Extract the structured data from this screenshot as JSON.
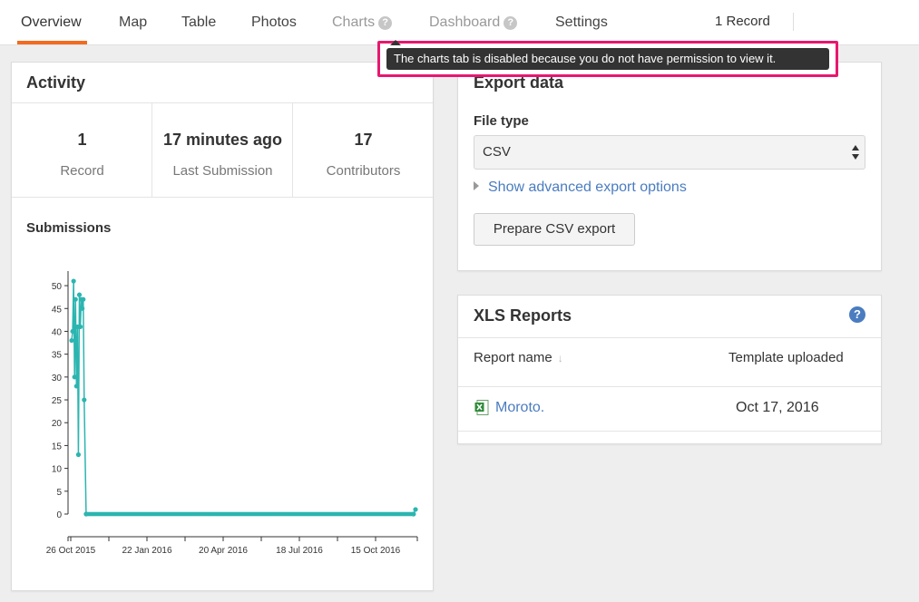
{
  "nav": {
    "tabs": [
      {
        "label": "Overview",
        "state": "active"
      },
      {
        "label": "Map",
        "state": "normal"
      },
      {
        "label": "Table",
        "state": "normal"
      },
      {
        "label": "Photos",
        "state": "normal"
      },
      {
        "label": "Charts",
        "state": "disabled",
        "help": "?"
      },
      {
        "label": "Dashboard",
        "state": "disabled",
        "help": "?"
      },
      {
        "label": "Settings",
        "state": "normal"
      }
    ],
    "record_count": "1 Record"
  },
  "tooltip": {
    "text": "The charts tab is disabled because you do not have permission to view it."
  },
  "activity": {
    "title": "Activity",
    "stats": [
      {
        "value": "1",
        "label": "Record"
      },
      {
        "value": "17 minutes ago",
        "label": "Last Submission"
      },
      {
        "value": "17",
        "label": "Contributors"
      }
    ],
    "submissions_title": "Submissions"
  },
  "chart_data": {
    "type": "line",
    "title": "Submissions",
    "xlabel": "",
    "ylabel": "",
    "x_tick_labels": [
      "26 Oct 2015",
      "22 Jan 2016",
      "20 Apr 2016",
      "18 Jul 2016",
      "15 Oct 2016"
    ],
    "x_range": [
      "2015-10-26",
      "2016-10-17"
    ],
    "y_ticks": [
      0,
      5,
      10,
      15,
      20,
      25,
      30,
      35,
      40,
      45,
      50
    ],
    "ylim": [
      0,
      52
    ],
    "grid": false,
    "series_color": "#2cb5b0",
    "points": [
      {
        "x": "2015-10-26",
        "y": 38
      },
      {
        "x": "2015-10-27",
        "y": 40
      },
      {
        "x": "2015-10-28",
        "y": 51
      },
      {
        "x": "2015-10-29",
        "y": 30
      },
      {
        "x": "2015-10-30",
        "y": 47
      },
      {
        "x": "2015-10-31",
        "y": 28
      },
      {
        "x": "2015-11-01",
        "y": 41
      },
      {
        "x": "2015-11-02",
        "y": 13
      },
      {
        "x": "2015-11-03",
        "y": 48
      },
      {
        "x": "2015-11-04",
        "y": 41
      },
      {
        "x": "2015-11-05",
        "y": 47
      },
      {
        "x": "2015-11-06",
        "y": 45
      },
      {
        "x": "2015-11-07",
        "y": 47
      },
      {
        "x": "2015-11-08",
        "y": 25
      },
      {
        "x": "2015-11-10",
        "y": 0
      },
      {
        "x": "2016-10-15",
        "y": 0
      },
      {
        "x": "2016-10-17",
        "y": 1
      }
    ],
    "zero_fill_from": "2015-11-10",
    "zero_fill_to": "2016-10-15"
  },
  "export": {
    "title": "Export data",
    "file_type_label": "File type",
    "file_type_value": "CSV",
    "advanced_link": "Show advanced export options",
    "prepare_button": "Prepare CSV export"
  },
  "xls": {
    "title": "XLS Reports",
    "help": "?",
    "col_report_name": "Report name",
    "col_template_uploaded": "Template uploaded",
    "rows": [
      {
        "name": "Moroto.",
        "uploaded": "Oct 17, 2016"
      }
    ]
  },
  "colors": {
    "accent": "#f26b21",
    "link": "#4a7cc0",
    "highlight_border": "#e8176f"
  }
}
